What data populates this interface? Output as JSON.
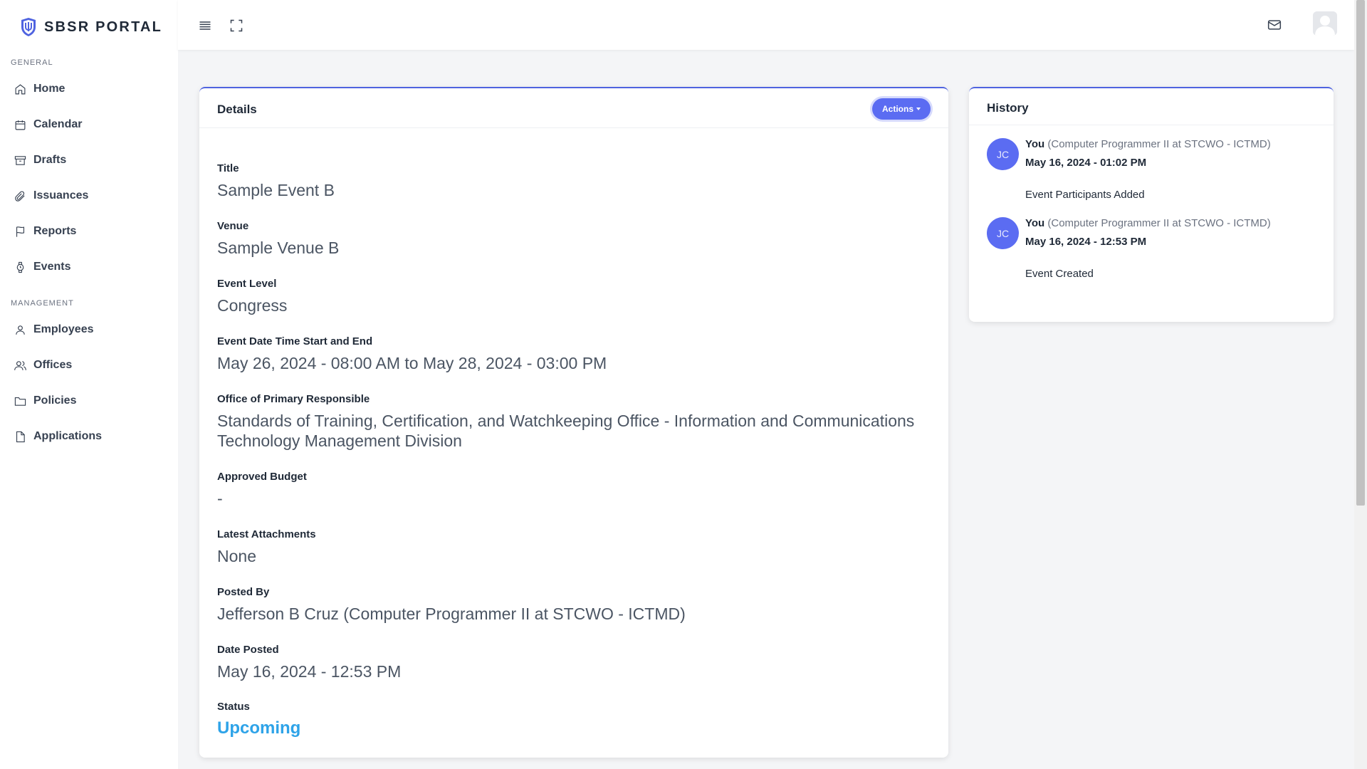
{
  "brand": {
    "name": "SBSR PORTAL"
  },
  "sidebar": {
    "sections": [
      {
        "heading": "GENERAL",
        "items": [
          {
            "label": "Home",
            "icon": "home-icon"
          },
          {
            "label": "Calendar",
            "icon": "calendar-icon"
          },
          {
            "label": "Drafts",
            "icon": "archive-icon"
          },
          {
            "label": "Issuances",
            "icon": "paperclip-icon"
          },
          {
            "label": "Reports",
            "icon": "flag-icon"
          },
          {
            "label": "Events",
            "icon": "watch-icon"
          }
        ]
      },
      {
        "heading": "MANAGEMENT",
        "items": [
          {
            "label": "Employees",
            "icon": "user-icon"
          },
          {
            "label": "Offices",
            "icon": "users-icon"
          },
          {
            "label": "Policies",
            "icon": "folder-icon"
          },
          {
            "label": "Applications",
            "icon": "file-icon"
          }
        ]
      }
    ]
  },
  "topbar": {
    "icons": [
      "menu-icon",
      "fullscreen-icon",
      "mail-icon",
      "profile-avatar"
    ]
  },
  "details": {
    "title": "Details",
    "actions_label": "Actions",
    "fields": [
      {
        "label": "Title",
        "value": "Sample Event B"
      },
      {
        "label": "Venue",
        "value": "Sample Venue B"
      },
      {
        "label": "Event Level",
        "value": "Congress"
      },
      {
        "label": "Event Date Time Start and End",
        "value": "May 26, 2024 - 08:00 AM to May 28, 2024 - 03:00 PM"
      },
      {
        "label": "Office of Primary Responsible",
        "value": "Standards of Training, Certification, and Watchkeeping Office - Information and Communications Technology Management Division"
      },
      {
        "label": "Approved Budget",
        "value": "-"
      },
      {
        "label": "Latest Attachments",
        "value": "None"
      },
      {
        "label": "Posted By",
        "value": "Jefferson B Cruz (Computer Programmer II at STCWO - ICTMD)"
      },
      {
        "label": "Date Posted",
        "value": "May 16, 2024 - 12:53 PM"
      },
      {
        "label": "Status",
        "value": "Upcoming"
      }
    ]
  },
  "history": {
    "title": "History",
    "entries": [
      {
        "initials": "JC",
        "actor": "You",
        "role": "(Computer Programmer II at STCWO - ICTMD)",
        "date": "May 16, 2024 - 01:02 PM",
        "action": "Event Participants Added"
      },
      {
        "initials": "JC",
        "actor": "You",
        "role": "(Computer Programmer II at STCWO - ICTMD)",
        "date": "May 16, 2024 - 12:53 PM",
        "action": "Event Created"
      }
    ]
  },
  "colors": {
    "accent": "#5b6cf2",
    "status": "#2ea3e8"
  }
}
